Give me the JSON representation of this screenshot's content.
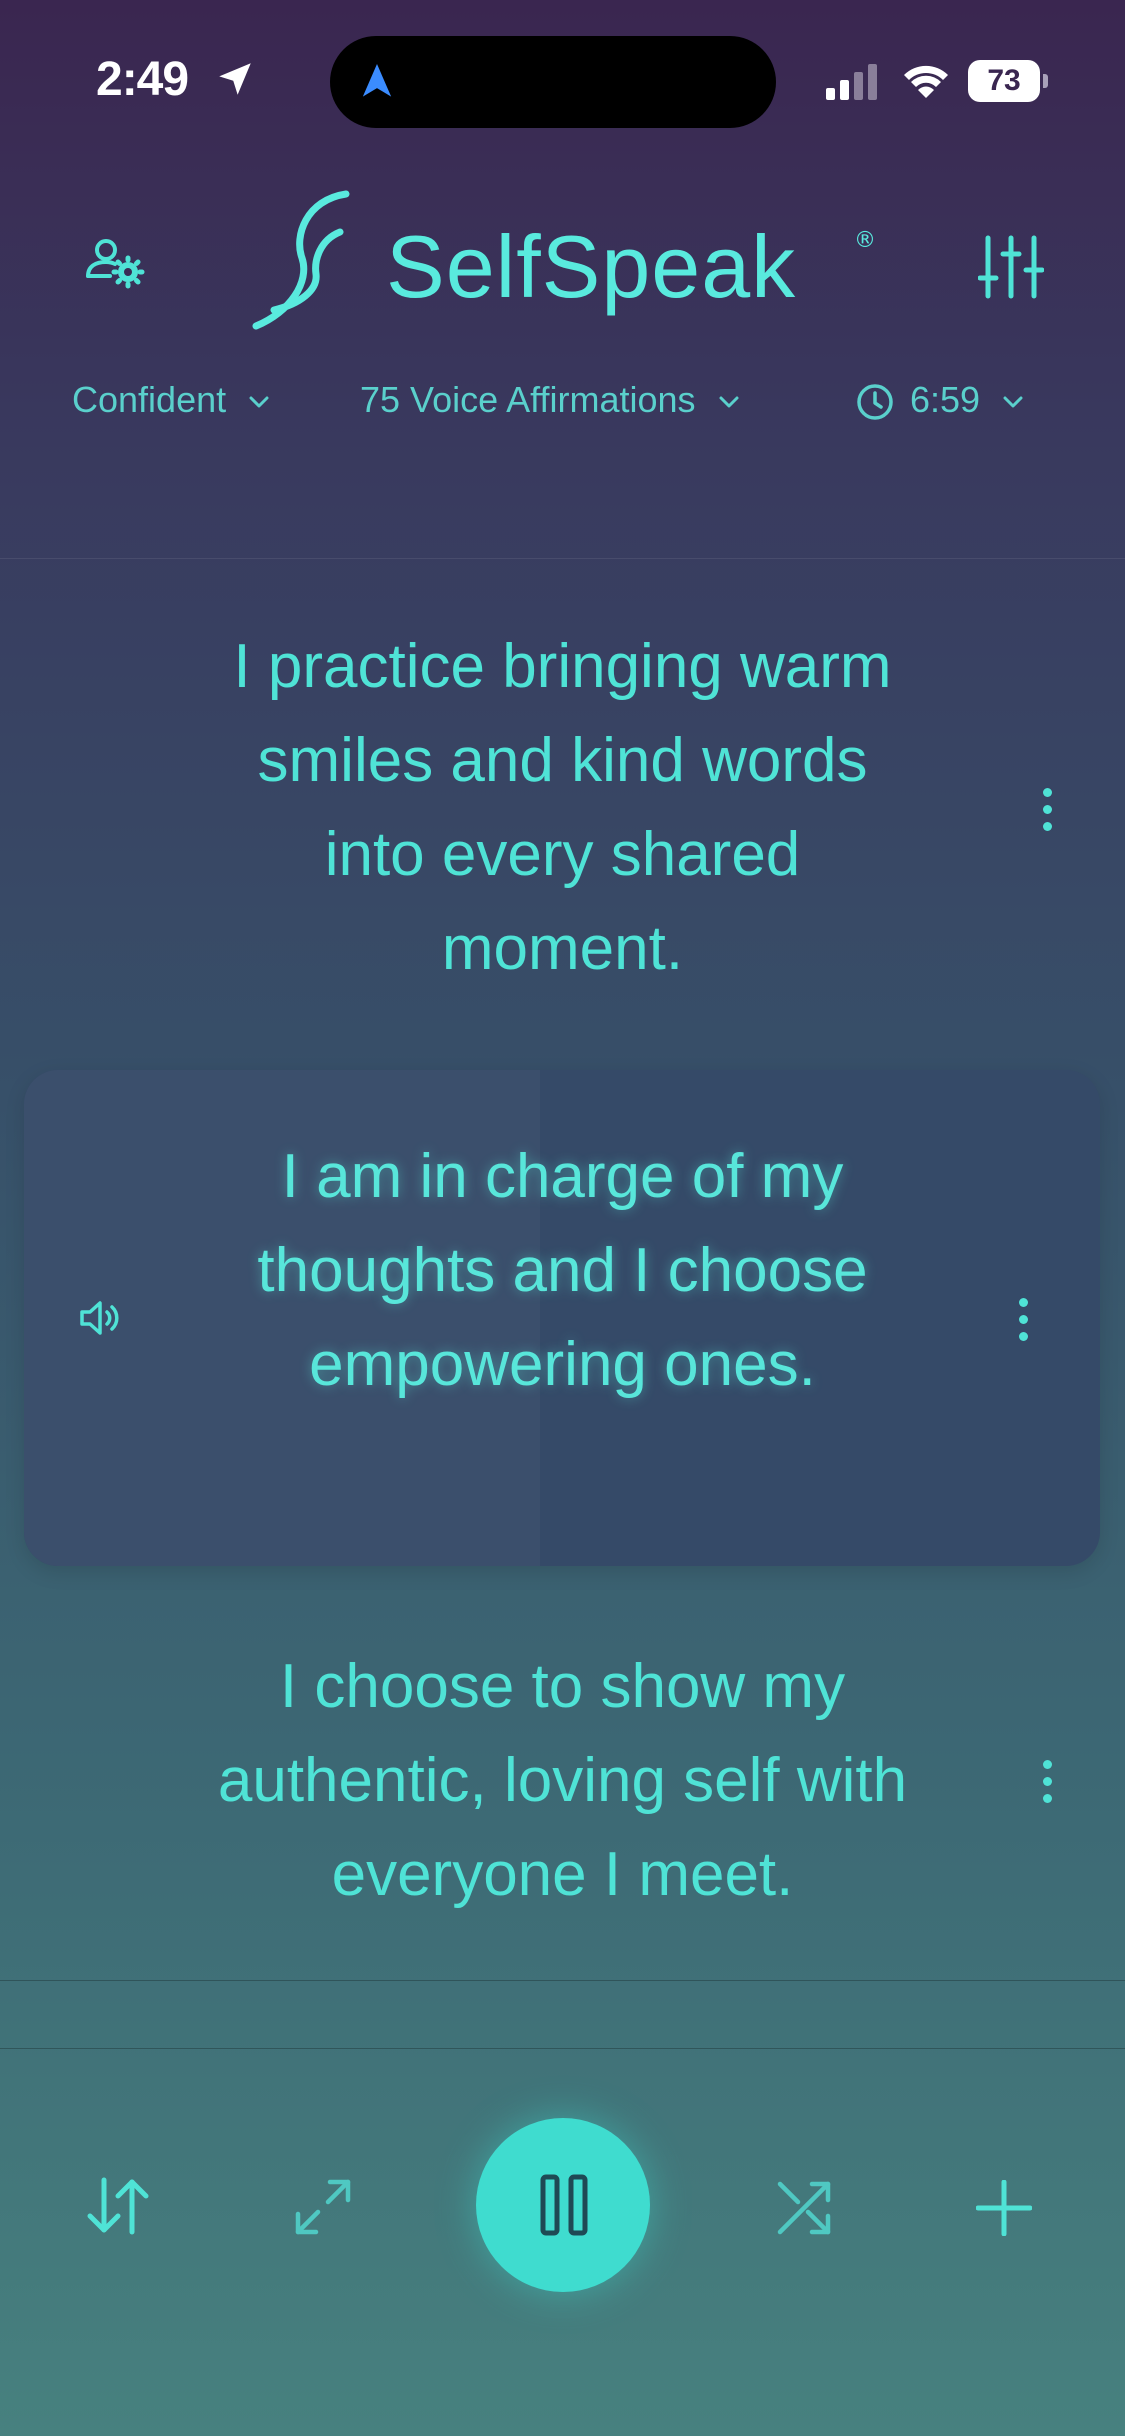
{
  "status_bar": {
    "time": "2:49",
    "battery": "73"
  },
  "header": {
    "app_name": "SelfSpeak",
    "registered_mark": "®",
    "icons": {
      "profile": "user-settings-icon",
      "filters": "sliders-icon"
    }
  },
  "selectors": {
    "focus": "Confident",
    "affirmation_count": "75 Voice Affirmations",
    "timer": "6:59"
  },
  "affirmations": [
    {
      "text": "I practice bringing warm smiles and kind words into every shared moment."
    },
    {
      "text": "I am in charge of my thoughts and I choose empowering ones.",
      "active": true,
      "progress_fraction": 0.48
    },
    {
      "text": "I choose to show my authentic, loving self with everyone I meet."
    }
  ],
  "controls": {
    "icons": [
      "sort-icon",
      "expand-icon",
      "pause-icon",
      "shuffle-icon",
      "plus-icon"
    ]
  },
  "colors": {
    "accent": "#4fe3d6",
    "play_button": "#3fdccf",
    "background_top": "#3a2650",
    "background_bottom": "#47817f"
  }
}
